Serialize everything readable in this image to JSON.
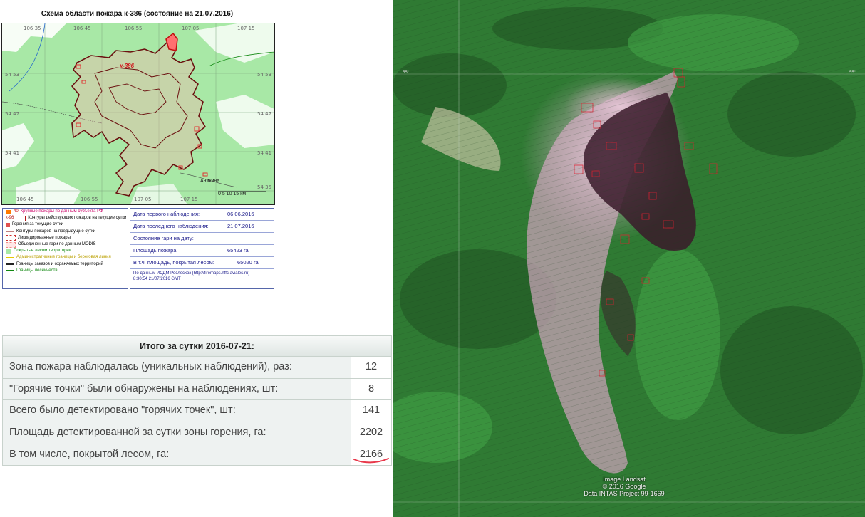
{
  "scheme": {
    "title": "Схема области пожара к-386 (состояние на 21.07.2016)",
    "fire_label": "к-386",
    "town_label": "Аникина",
    "scale_label": "0    5    10    15 км",
    "coords_top": [
      "106 35",
      "106 45",
      "106 55",
      "107 05",
      "107 15"
    ],
    "coords_right": [
      "54 53",
      "54 47",
      "54 41",
      "54 35"
    ],
    "coords_left": [
      "54 53",
      "54 47",
      "54 41"
    ],
    "coords_bottom": [
      "106 45",
      "106 55",
      "107 05",
      "107 15"
    ],
    "colors": {
      "map_bg": "#a8e8a6",
      "fire_outline": "#6b1010",
      "fire_fill": "#ff9a9a",
      "roads": "#555555",
      "scheme_bg_white": "#ffffff"
    }
  },
  "legend": {
    "items": [
      {
        "label": "Крупные пожары по данным субъекта РФ",
        "color": "#ff7a00",
        "prefix": "40"
      },
      {
        "label": "Контуры действующих пожаров на текущие сутки",
        "color": "#b01414",
        "prefix": "к-96"
      },
      {
        "label": "Горения за текущие сутки",
        "color": "#e05050",
        "prefix": ""
      },
      {
        "label": "Контуры пожаров на предыдущие сутки",
        "color": "#c08080",
        "prefix": ""
      },
      {
        "label": "Ликвидированные пожары",
        "color": "#d03030",
        "prefix": ""
      },
      {
        "label": "Объединенные гари по данным MODIS",
        "color": "#f08a8a",
        "prefix": ""
      },
      {
        "label": "Покрытые лесом территории",
        "color": "#a8e8a6",
        "prefix": ""
      },
      {
        "label": "Административные границы и береговая линия",
        "color": "#e6c800",
        "prefix": ""
      },
      {
        "label": "Границы заказов и охраняемых территорий",
        "color": "#222222",
        "prefix": ""
      },
      {
        "label": "Границы лесничеств",
        "color": "#118811",
        "prefix": ""
      }
    ]
  },
  "info": {
    "first_obs_label": "Дата первого наблюдения:",
    "first_obs_value": "06.06.2016",
    "last_obs_label": "Дата последнего наблюдения:",
    "last_obs_value": "21.07.2016",
    "state_label": "Состояние гари на дату:",
    "area_label": "Площадь пожара:",
    "area_value": "65423 га",
    "forest_label": "В т.ч. площадь, покрытая лесом:",
    "forest_value": "65020 га",
    "source": "По данным ИСДМ Рослесхоз (http://firemaps.nffc.aviales.ru)",
    "timestamp": "8:30:54 21/07/2016 GMT"
  },
  "summary": {
    "header": "Итого за сутки 2016-07-21:",
    "rows": [
      {
        "label": "Зона пожара наблюдалась (уникальных наблюдений), раз:",
        "value": "12"
      },
      {
        "label": "\"Горячие точки\" были обнаружены на наблюдениях, шт:",
        "value": "8"
      },
      {
        "label": "Всего было детектировано \"горячих точек\", шт:",
        "value": "141"
      },
      {
        "label": "Площадь детектированной за сутки зоны горения, га:",
        "value": "2202"
      },
      {
        "label": "В том числе, покрытой лесом, га:",
        "value": "2166"
      }
    ],
    "underline_color": "#e8384a"
  },
  "satellite": {
    "credit_1": "Image Landsat",
    "credit_2": "© 2016 Google",
    "credit_3": "Data INTAS Project 99-1669",
    "colors": {
      "forest": "#2f7a33",
      "forest_dark": "#1f4f22",
      "smoke": "#d8b8c8",
      "burn": "#3a1a2a",
      "fire_contours": "#e02030"
    }
  }
}
